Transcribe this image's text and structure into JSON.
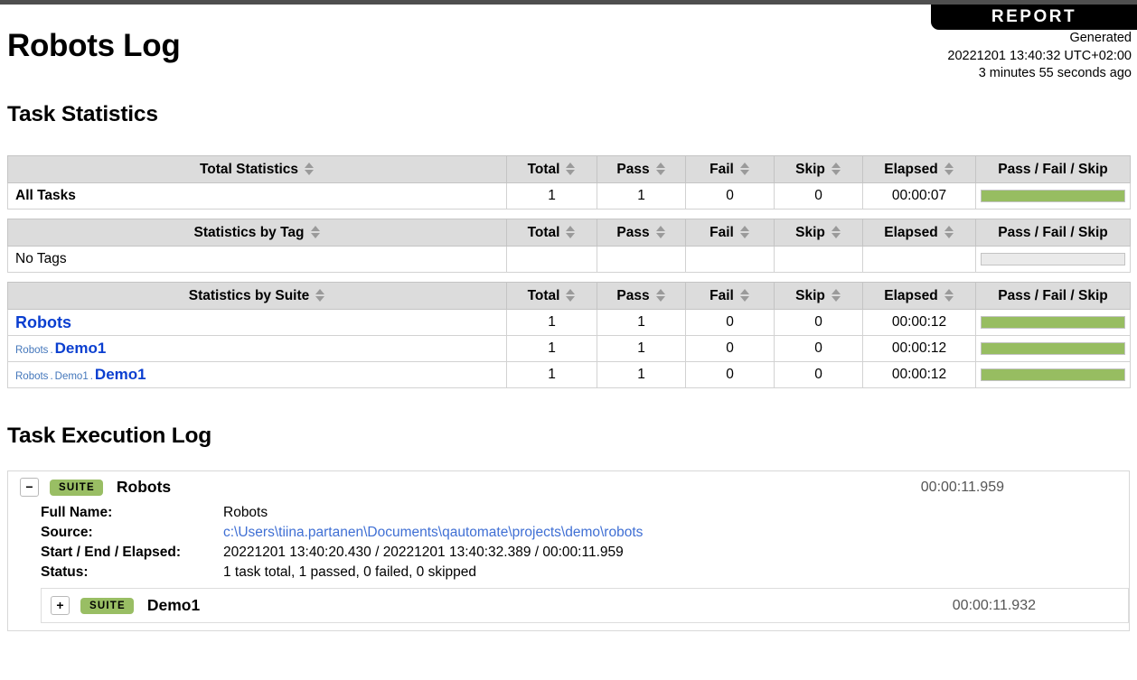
{
  "header": {
    "banner_label": "REPORT",
    "title": "Robots Log",
    "generated_label": "Generated",
    "generated_time": "20221201 13:40:32 UTC+02:00",
    "generated_ago": "3 minutes 55 seconds ago"
  },
  "statistics": {
    "heading": "Task Statistics",
    "columns": [
      "Total",
      "Pass",
      "Fail",
      "Skip",
      "Elapsed",
      "Pass / Fail / Skip"
    ],
    "tables": [
      {
        "name_header": "Total Statistics",
        "rows": [
          {
            "name": "All Tasks",
            "bold": true,
            "total": "1",
            "pass": "1",
            "fail": "0",
            "skip": "0",
            "elapsed": "00:00:07",
            "pass_pct": 100
          }
        ]
      },
      {
        "name_header": "Statistics by Tag",
        "rows": [
          {
            "name": "No Tags",
            "bold": false,
            "total": "",
            "pass": "",
            "fail": "",
            "skip": "",
            "elapsed": "",
            "pass_pct": 0
          }
        ]
      },
      {
        "name_header": "Statistics by Suite",
        "rows": [
          {
            "parents": [],
            "name": "Robots",
            "is_link": true,
            "total": "1",
            "pass": "1",
            "fail": "0",
            "skip": "0",
            "elapsed": "00:00:12",
            "pass_pct": 100
          },
          {
            "parents": [
              "Robots"
            ],
            "name": "Demo1",
            "is_link": true,
            "total": "1",
            "pass": "1",
            "fail": "0",
            "skip": "0",
            "elapsed": "00:00:12",
            "pass_pct": 100
          },
          {
            "parents": [
              "Robots",
              "Demo1"
            ],
            "name": "Demo1",
            "is_link": true,
            "total": "1",
            "pass": "1",
            "fail": "0",
            "skip": "0",
            "elapsed": "00:00:12",
            "pass_pct": 100
          }
        ]
      }
    ]
  },
  "execution_log": {
    "heading": "Task Execution Log",
    "root_suite": {
      "expander": "−",
      "badge": "SUITE",
      "name": "Robots",
      "elapsed": "00:00:11.959",
      "details": [
        {
          "label": "Full Name:",
          "value": "Robots",
          "is_link": false
        },
        {
          "label": "Source:",
          "value": "c:\\Users\\tiina.partanen\\Documents\\qautomate\\projects\\demo\\robots",
          "is_link": true
        },
        {
          "label": "Start / End / Elapsed:",
          "value": "20221201 13:40:20.430 / 20221201 13:40:32.389 / 00:00:11.959",
          "is_link": false
        },
        {
          "label": "Status:",
          "value": "1 task total, 1 passed, 0 failed, 0 skipped",
          "is_link": false
        }
      ],
      "child_suite": {
        "expander": "+",
        "badge": "SUITE",
        "name": "Demo1",
        "elapsed": "00:00:11.932"
      }
    }
  },
  "colors": {
    "pass_green": "#97bd61",
    "badge_green": "#99be64",
    "header_gray": "#dcdcdc",
    "top_rule": "#4f4f4f",
    "link_blue": "#3f6fd4",
    "suite_blue": "#0b3fd0"
  }
}
